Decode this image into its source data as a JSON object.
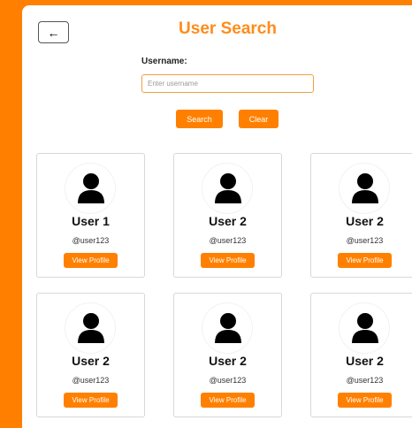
{
  "header": {
    "back_label": "←",
    "title": "User Search"
  },
  "search": {
    "label": "Username:",
    "value": "",
    "placeholder": "Enter username",
    "search_label": "Search",
    "clear_label": "Clear"
  },
  "cards": [
    {
      "name": "User 1",
      "handle": "@user123",
      "button": "View Profile"
    },
    {
      "name": "User 2",
      "handle": "@user123",
      "button": "View Profile"
    },
    {
      "name": "User 2",
      "handle": "@user123",
      "button": "View Profile"
    },
    {
      "name": "User 2",
      "handle": "@user123",
      "button": "View Profile"
    },
    {
      "name": "User 2",
      "handle": "@user123",
      "button": "View Profile"
    },
    {
      "name": "User 2",
      "handle": "@user123",
      "button": "View Profile"
    }
  ],
  "colors": {
    "accent": "#ff8000",
    "title": "#ff8c1a",
    "card_border": "#d8d8d8"
  },
  "icons": {
    "back": "arrow-left-icon",
    "avatar": "user-silhouette-icon"
  }
}
